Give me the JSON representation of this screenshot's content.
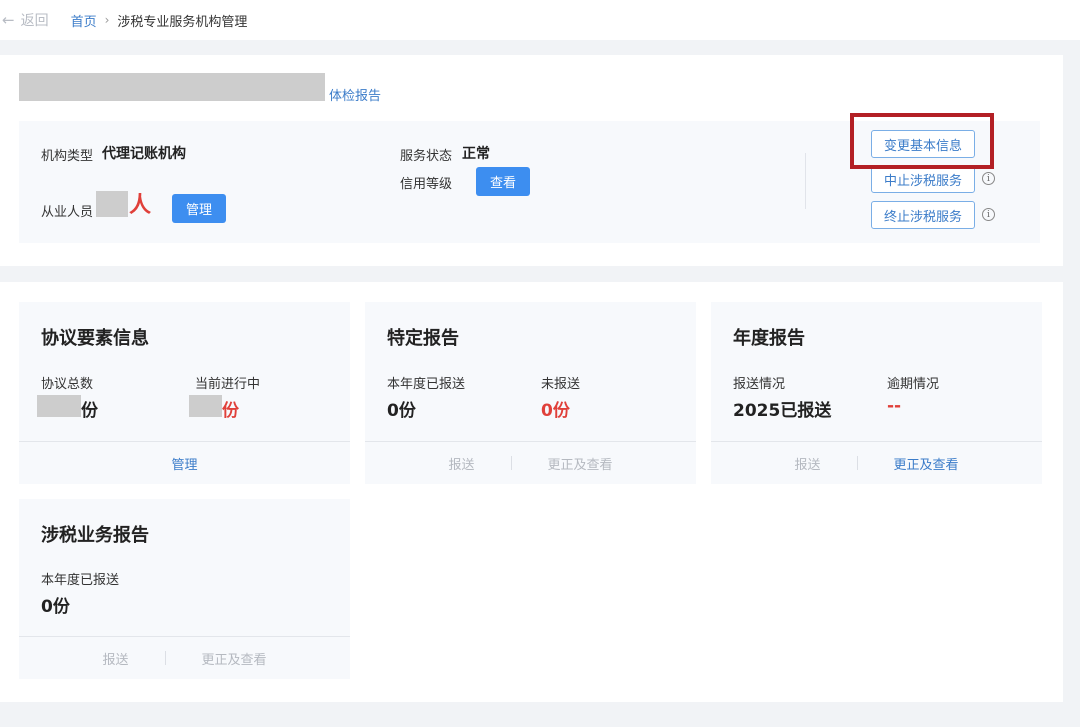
{
  "nav": {
    "back_label": "返回",
    "home_label": "首页",
    "separator": "›",
    "current_label": "涉税专业服务机构管理"
  },
  "org": {
    "report_link": "体检报告",
    "type_label": "机构类型",
    "type_value": "代理记账机构",
    "staff_label": "从业人员",
    "staff_unit": "人",
    "manage_button": "管理",
    "status_label": "服务状态",
    "status_value": "正常",
    "credit_label": "信用等级",
    "view_button": "查看",
    "change_info_button": "变更基本信息",
    "suspend_button": "中止涉税服务",
    "terminate_button": "终止涉税服务"
  },
  "panels": {
    "agreement": {
      "title": "协议要素信息",
      "total_label": "协议总数",
      "total_unit": "份",
      "ongoing_label": "当前进行中",
      "ongoing_unit": "份",
      "footer_link": "管理"
    },
    "special": {
      "title": "特定报告",
      "submitted_label": "本年度已报送",
      "submitted_value": "0份",
      "unsubmitted_label": "未报送",
      "unsubmitted_value": "0份",
      "submit_action": "报送",
      "correct_action": "更正及查看"
    },
    "annual": {
      "title": "年度报告",
      "status_label": "报送情况",
      "status_value": "2025已报送",
      "overdue_label": "逾期情况",
      "overdue_value": "--",
      "submit_action": "报送",
      "correct_action": "更正及查看"
    },
    "tax_business": {
      "title": "涉税业务报告",
      "submitted_label": "本年度已报送",
      "submitted_value": "0份",
      "submit_action": "报送",
      "correct_action": "更正及查看"
    }
  },
  "colors": {
    "primary": "#3d8ef0",
    "link": "#3b7cc9",
    "alert": "#e0403a",
    "highlight_box": "#b32025"
  }
}
